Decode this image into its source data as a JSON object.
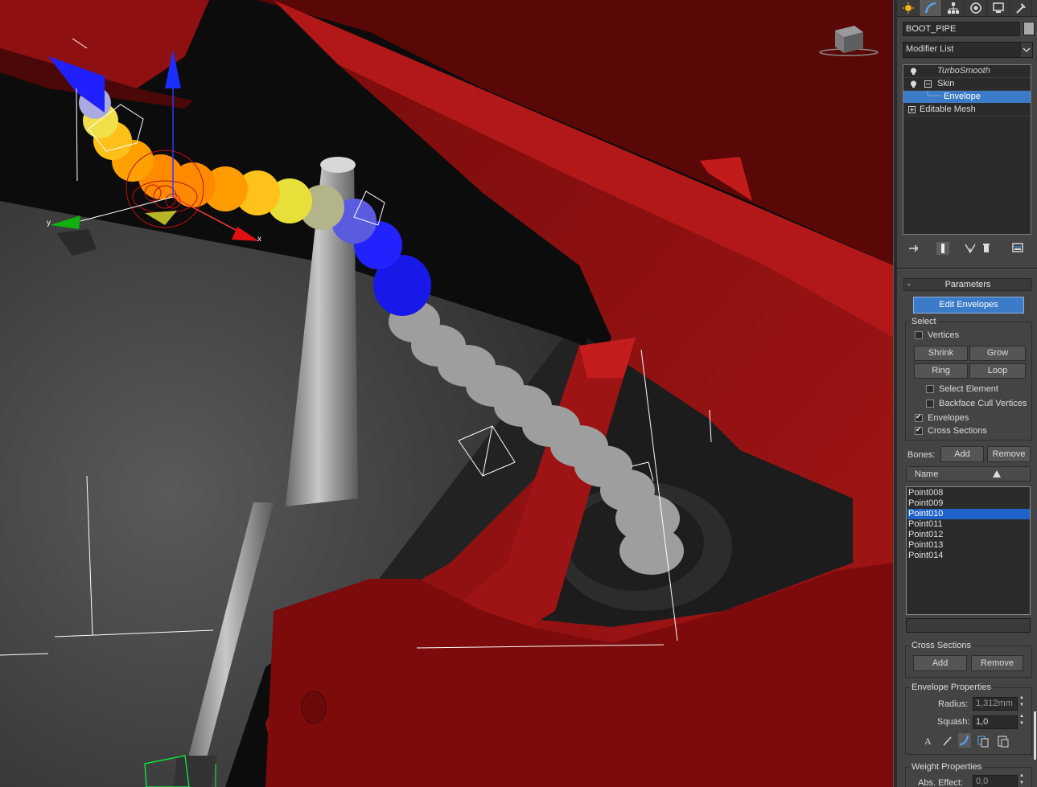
{
  "viewport": {
    "axis_labels": {
      "x": "x",
      "y": "y"
    },
    "colors": {
      "body": "#8b0f0f",
      "shock": "#9a9a9a",
      "envelope_hot": "#ff8a00",
      "envelope_cold": "#1a1aff"
    }
  },
  "command_panel": {
    "tabs": [
      "create-icon",
      "modify-icon",
      "hierarchy-icon",
      "motion-icon",
      "display-icon",
      "utilities-icon"
    ],
    "object_name": "BOOT_PIPE",
    "modifier_list": "Modifier List",
    "stack": {
      "turbosmooth": "TurboSmooth",
      "skin": "Skin",
      "envelope": "Envelope",
      "editable_mesh": "Editable Mesh"
    }
  },
  "parameters": {
    "title": "Parameters",
    "edit_envelopes": "Edit Envelopes",
    "select": {
      "label": "Select",
      "vertices": "Vertices",
      "shrink": "Shrink",
      "grow": "Grow",
      "ring": "Ring",
      "loop": "Loop",
      "select_element": "Select Element",
      "backface_cull": "Backface Cull Vertices",
      "envelopes": "Envelopes",
      "cross_sections": "Cross Sections"
    },
    "bones": {
      "label": "Bones:",
      "add": "Add",
      "remove": "Remove",
      "column": "Name",
      "items": [
        "Point008",
        "Point009",
        "Point010",
        "Point011",
        "Point012",
        "Point013",
        "Point014"
      ],
      "selected_index": 2
    },
    "cross_sections": {
      "label": "Cross Sections",
      "add": "Add",
      "remove": "Remove"
    },
    "envelope_properties": {
      "label": "Envelope Properties",
      "radius_label": "Radius:",
      "radius_value": "1,312mm",
      "squash_label": "Squash:",
      "squash_value": "1,0"
    },
    "weight_properties": {
      "label": "Weight Properties",
      "abs_effect_label": "Abs. Effect:",
      "abs_effect_value": "0,0"
    }
  }
}
